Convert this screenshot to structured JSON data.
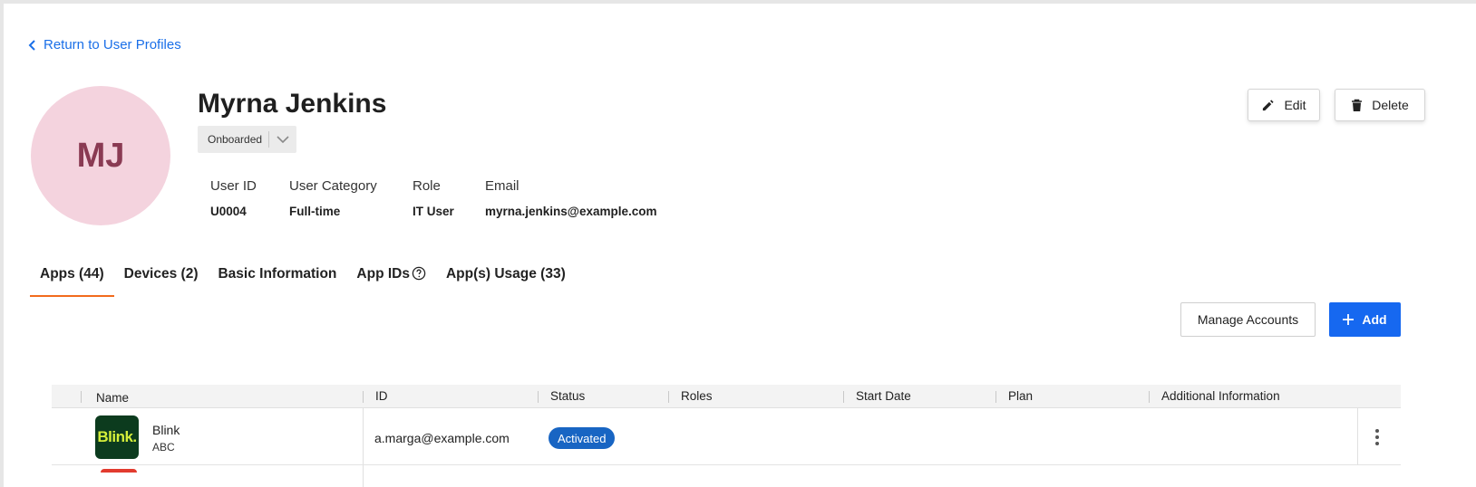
{
  "back_link": {
    "label": "Return to User Profiles"
  },
  "profile": {
    "initials": "MJ",
    "name": "Myrna Jenkins",
    "status": "Onboarded",
    "fields": [
      {
        "label": "User ID",
        "value": "U0004"
      },
      {
        "label": "User Category",
        "value": "Full-time"
      },
      {
        "label": "Role",
        "value": "IT User"
      },
      {
        "label": "Email",
        "value": "myrna.jenkins@example.com"
      }
    ]
  },
  "actions": {
    "edit": "Edit",
    "delete": "Delete"
  },
  "tabs": [
    {
      "label": "Apps (44)",
      "active": true
    },
    {
      "label": "Devices (2)"
    },
    {
      "label": "Basic Information"
    },
    {
      "label": "App IDs",
      "help_icon": "question-circle-icon"
    },
    {
      "label": "App(s) Usage (33)"
    }
  ],
  "toolbar": {
    "manage": "Manage Accounts",
    "add": "Add"
  },
  "table": {
    "columns": [
      "Name",
      "ID",
      "Status",
      "Roles",
      "Start Date",
      "Plan",
      "Additional Information"
    ],
    "rows": [
      {
        "logo_text": "Blink.",
        "name": "Blink",
        "sub": "ABC",
        "id": "a.marga@example.com",
        "status": "Activated",
        "roles": "",
        "start_date": "",
        "plan": "",
        "additional": ""
      }
    ]
  },
  "colors": {
    "accent": "#1668f0",
    "tab_underline": "#f26b1d",
    "avatar_bg": "#f4d3de",
    "badge": "#1865c3"
  }
}
